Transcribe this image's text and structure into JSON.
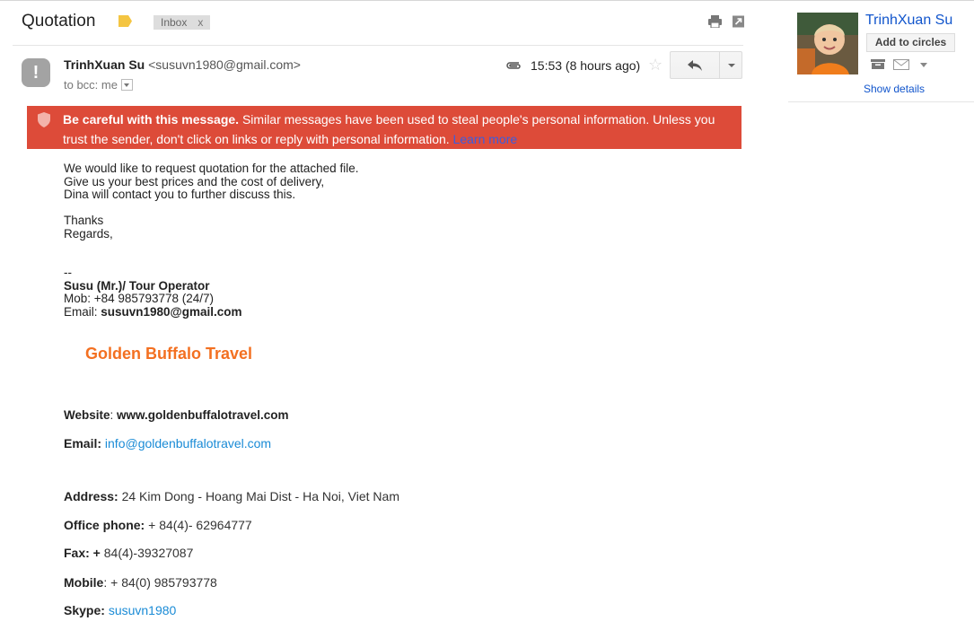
{
  "header": {
    "subject": "Quotation",
    "inbox_chip": {
      "label": "Inbox",
      "remove": "x"
    },
    "icons": [
      "print-icon",
      "new-window-icon"
    ]
  },
  "message": {
    "sender_name": "TrinhXuan Su",
    "sender_email": "<susuvn1980@gmail.com>",
    "recipient_line": "to bcc: me",
    "time": "15:53 (8 hours ago)"
  },
  "warning": {
    "title": "Be careful with this message.",
    "text": " Similar messages have been used to steal people's personal information. Unless you trust the sender, don't click on links or reply with personal information. ",
    "learn_more": "Learn more"
  },
  "body": {
    "lines": [
      "We would like to request quotation for the attached file.",
      "Give us your best prices and the cost of delivery,",
      "Dina will contact you to further discuss this."
    ],
    "closing": [
      "Thanks",
      "Regards,"
    ],
    "sig_dash": "--",
    "sig_name": "Susu (Mr.)/ Tour Operator",
    "sig_mob": "Mob: +84 985793778 (24/7)",
    "sig_email_label": "Email: ",
    "sig_email": "susuvn1980@gmail.com"
  },
  "company": {
    "name": "Golden Buffalo Travel",
    "website_label": "Website",
    "website_sep": ": ",
    "website": "www.goldenbuffalotravel.com",
    "email_label": "Email:",
    "email": "info@goldenbuffalotravel.com",
    "address_label": "Address:",
    "address": "24 Kim Dong - Hoang Mai Dist - Ha Noi, Viet Nam",
    "office_label": "Office phone:",
    "office": "+ 84(4)- 62964777",
    "fax_label": "Fax: +",
    "fax": "84(4)-39327087",
    "mobile_label": "Mobile",
    "mobile": ": + 84(0) 985793778",
    "skype_label": "Skype:",
    "skype": "susuvn1980"
  },
  "profile": {
    "name": "TrinhXuan Su",
    "add_button": "Add to circles",
    "show_details": "Show details"
  },
  "colors": {
    "warning_bg": "#dd4b39",
    "brand_orange": "#f37021",
    "link_blue": "#1a8bd6",
    "gmail_blue": "#1155cc"
  }
}
